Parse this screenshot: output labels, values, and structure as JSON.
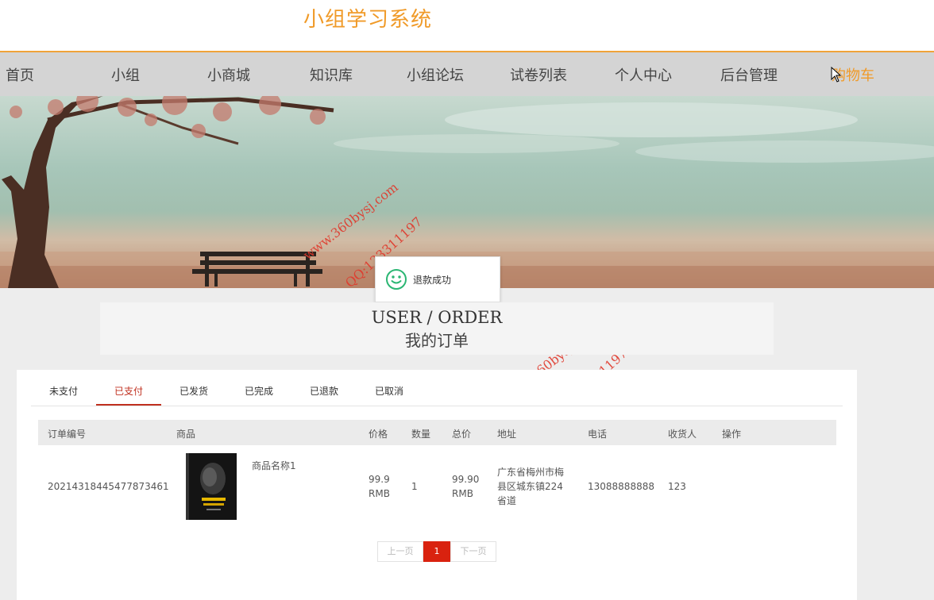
{
  "site": {
    "title": "小组学习系统"
  },
  "nav": {
    "items": [
      {
        "label": "首页"
      },
      {
        "label": "小组"
      },
      {
        "label": "小商城"
      },
      {
        "label": "知识库"
      },
      {
        "label": "小组论坛"
      },
      {
        "label": "试卷列表"
      },
      {
        "label": "个人中心"
      },
      {
        "label": "后台管理"
      },
      {
        "label": "购物车"
      }
    ],
    "active_index": 8
  },
  "watermarks": {
    "url": "www.360bysj.com",
    "qq": "QQ:123311197"
  },
  "toast": {
    "message": "退款成功",
    "icon": "smile-icon"
  },
  "page_title": {
    "en": "USER / ORDER",
    "cn": "我的订单"
  },
  "tabs": {
    "items": [
      {
        "label": "未支付"
      },
      {
        "label": "已支付"
      },
      {
        "label": "已发货"
      },
      {
        "label": "已完成"
      },
      {
        "label": "已退款"
      },
      {
        "label": "已取消"
      }
    ],
    "active_index": 1
  },
  "table": {
    "headers": {
      "order_no": "订单编号",
      "product": "商品",
      "price": "价格",
      "qty": "数量",
      "total": "总价",
      "address": "地址",
      "phone": "电话",
      "receiver": "收货人",
      "action": "操作"
    },
    "rows": [
      {
        "order_no": "20214318445477873461",
        "product_name": "商品名称1",
        "price_value": "99.9",
        "price_unit": "RMB",
        "qty": "1",
        "total_value": "99.90",
        "total_unit": "RMB",
        "address_line1": "广东省梅州市梅",
        "address_line2": "县区城东镇224",
        "address_line3": "省道",
        "phone": "13088888888",
        "receiver": "123"
      }
    ]
  },
  "pagination": {
    "prev": "上一页",
    "current": "1",
    "next": "下一页"
  },
  "colors": {
    "accent": "#f09a28",
    "active_tab": "#c0301f",
    "page_current": "#d9220f",
    "watermark": "#e0392c",
    "toast_icon": "#2bb673"
  }
}
